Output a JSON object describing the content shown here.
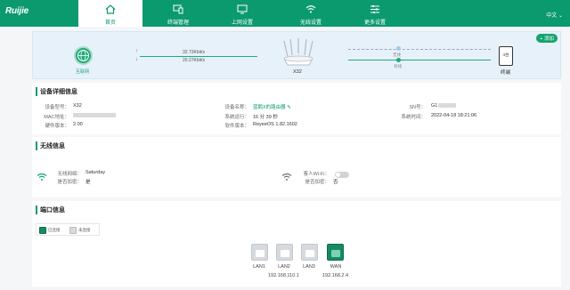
{
  "brand": {
    "logo": "Ruijie",
    "accent": "#0b9a6e"
  },
  "nav": {
    "items": [
      {
        "label": "首页",
        "icon": "home-icon",
        "active": true
      },
      {
        "label": "终端管理",
        "icon": "devices-icon",
        "active": false
      },
      {
        "label": "上网设置",
        "icon": "internet-settings-icon",
        "active": false
      },
      {
        "label": "无线设置",
        "icon": "wifi-icon",
        "active": false
      },
      {
        "label": "更多设置",
        "icon": "sliders-icon",
        "active": false
      }
    ],
    "language": "中文 ⌄"
  },
  "status": {
    "add_label": "+ 添加",
    "internet_label": "互联网",
    "upload_speed": "32.73Kbit/s",
    "download_speed": "20.27Kbit/s",
    "router_label": "X32",
    "wireless_label": "无线",
    "wired_label": "有线",
    "terminal_count": "4台",
    "terminal_label": "终端"
  },
  "device_info": {
    "title": "设备详细信息",
    "model_key": "设备型号：",
    "model_val": "X32",
    "mac_key": "MAC地址：",
    "hw_key": "硬件版本：",
    "hw_val": "2.00",
    "name_key": "设备名称：",
    "name_val": "蓝鹅X的路由器 ✎",
    "uptime_key": "系统运行：",
    "uptime_val": "16 分 39 秒",
    "sw_key": "软件版本：",
    "sw_val": "ReyeeOS 1.82.1602",
    "sn_key": "SN号：",
    "sn_val": "G1",
    "time_key": "系统时间：",
    "time_val": "2022-04-18 18:21:06"
  },
  "wireless_info": {
    "title": "无线信息",
    "ssid_key": "无线网络：",
    "ssid_val": "Saturday",
    "enc_key": "是否加密：",
    "enc_val": "是",
    "guest_key": "客人Wi-Fi：",
    "guest_enc_key": "是否加密：",
    "guest_enc_val": "否"
  },
  "port_info": {
    "title": "端口信息",
    "legend_connected": "已连接",
    "legend_disconnected": "未连接",
    "ports": [
      {
        "name": "LAN1",
        "connected": false
      },
      {
        "name": "LAN2",
        "connected": false
      },
      {
        "name": "LAN3",
        "connected": false
      },
      {
        "name": "WAN",
        "connected": true
      }
    ],
    "lan_ip": "192.168.110.1",
    "wan_ip": "192.168.2.4"
  }
}
